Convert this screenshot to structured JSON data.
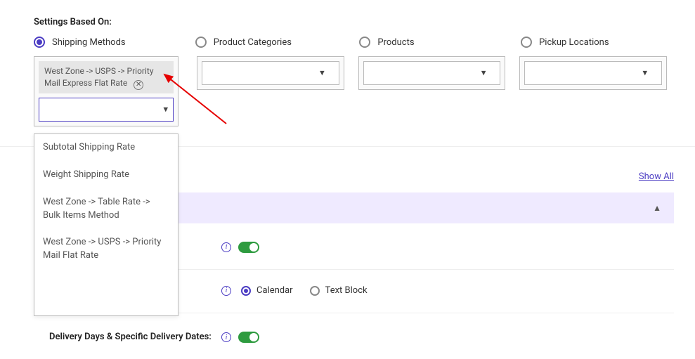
{
  "title": "Settings Based On:",
  "radios": {
    "shipping_methods": "Shipping Methods",
    "product_categories": "Product Categories",
    "products": "Products",
    "pickup_locations": "Pickup Locations"
  },
  "selected_chip": "West Zone -> USPS -> Priority Mail Express Flat Rate",
  "combo_value": "",
  "dropdown_options": [
    "Subtotal Shipping Rate",
    "Weight Shipping Rate",
    "West Zone -> Table Rate -> Bulk Items Method",
    "West Zone -> USPS -> Priority Mail Flat Rate"
  ],
  "show_all": "Show All",
  "settings": {
    "row2": {
      "option_calendar": "Calendar",
      "option_textblock": "Text Block"
    },
    "row3_label": "Delivery Days & Specific Delivery Dates:"
  }
}
